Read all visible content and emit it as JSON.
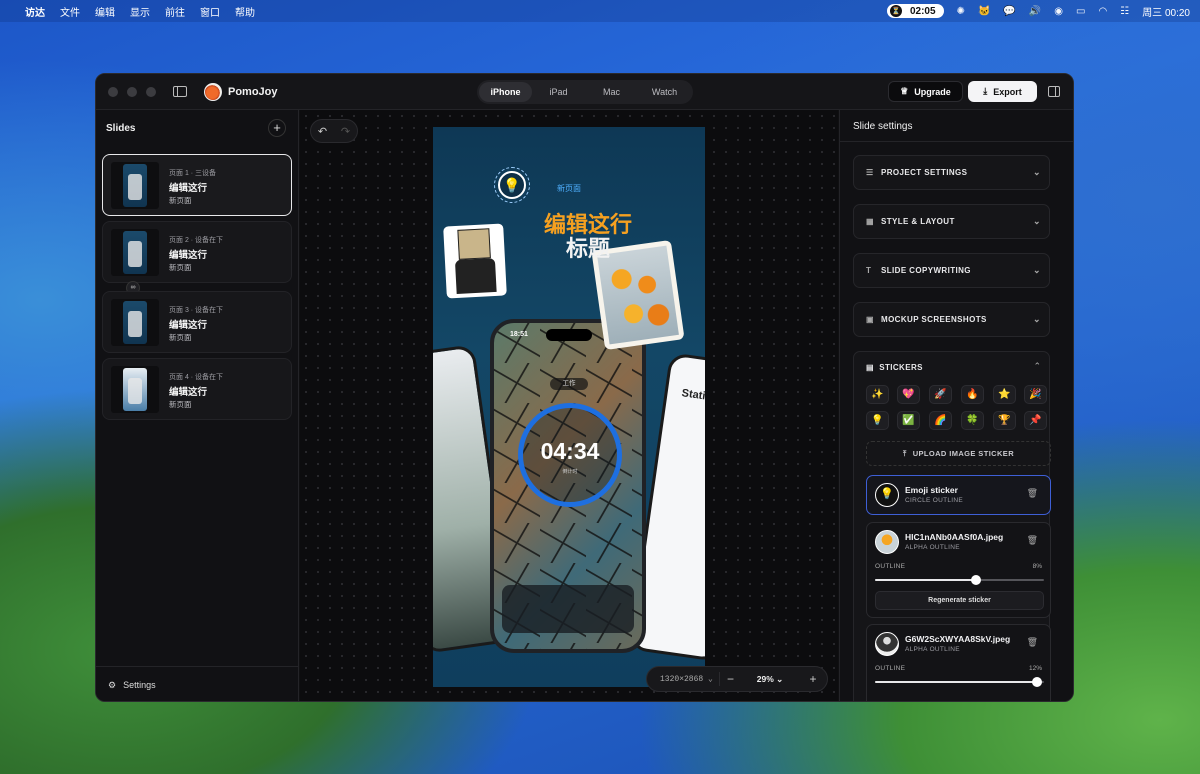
{
  "menubar": {
    "apple": "",
    "items": [
      "访达",
      "文件",
      "编辑",
      "显示",
      "前往",
      "窗口",
      "帮助"
    ],
    "timer": "02:05",
    "clock": "周三 00:20"
  },
  "titlebar": {
    "app_name": "PomoJoy",
    "device_tabs": [
      "iPhone",
      "iPad",
      "Mac",
      "Watch"
    ],
    "active_tab": "iPhone",
    "upgrade_label": "Upgrade",
    "export_label": "Export"
  },
  "sidebar": {
    "title": "Slides",
    "add_icon": "+",
    "slides": [
      {
        "subtitle": "页面 1 · 三设备",
        "title": "编辑这行",
        "caption": "新页面",
        "selected": true
      },
      {
        "subtitle": "页面 2 · 设备在下",
        "title": "编辑这行",
        "caption": "新页面",
        "selected": false
      },
      {
        "subtitle": "页面 3 · 设备在下",
        "title": "编辑这行",
        "caption": "新页面",
        "selected": false
      },
      {
        "subtitle": "页面 4 · 设备在下",
        "title": "编辑这行",
        "caption": "新页面",
        "selected": false
      }
    ],
    "settings_label": "Settings"
  },
  "canvas": {
    "page_tag": "新页面",
    "headline_line1": "编辑这行",
    "headline_line2": "标题",
    "phone_time": "18:51",
    "phone_chip": "工作",
    "phone_clock": "04:34",
    "phone_clock_sub": "倒计时",
    "right_phone_title": "Statistic",
    "resolution": "1320×2868",
    "zoom": "29%"
  },
  "settings_panel": {
    "title": "Slide settings",
    "sections": [
      "PROJECT SETTINGS",
      "STYLE & LAYOUT",
      "SLIDE COPYWRITING",
      "MOCKUP SCREENSHOTS"
    ],
    "stickers_title": "STICKERS",
    "emojis": [
      "✨",
      "💖",
      "🚀",
      "🔥",
      "⭐",
      "🎉",
      "💡",
      "✅",
      "🌈",
      "🍀",
      "🏆",
      "📌"
    ],
    "upload_label": "UPLOAD IMAGE STICKER",
    "sticker_items": [
      {
        "name": "Emoji sticker",
        "type": "CIRCLE OUTLINE"
      },
      {
        "name": "HIC1nANb0AASf0A.jpeg",
        "type": "ALPHA OUTLINE",
        "outline_label": "OUTLINE",
        "outline_pct": "8%",
        "outline_value": 0.6,
        "regen_label": "Regenerate sticker"
      },
      {
        "name": "G6W2ScXWYAA8SkV.jpeg",
        "type": "ALPHA OUTLINE",
        "outline_label": "OUTLINE",
        "outline_pct": "12%",
        "outline_value": 0.96
      }
    ]
  }
}
